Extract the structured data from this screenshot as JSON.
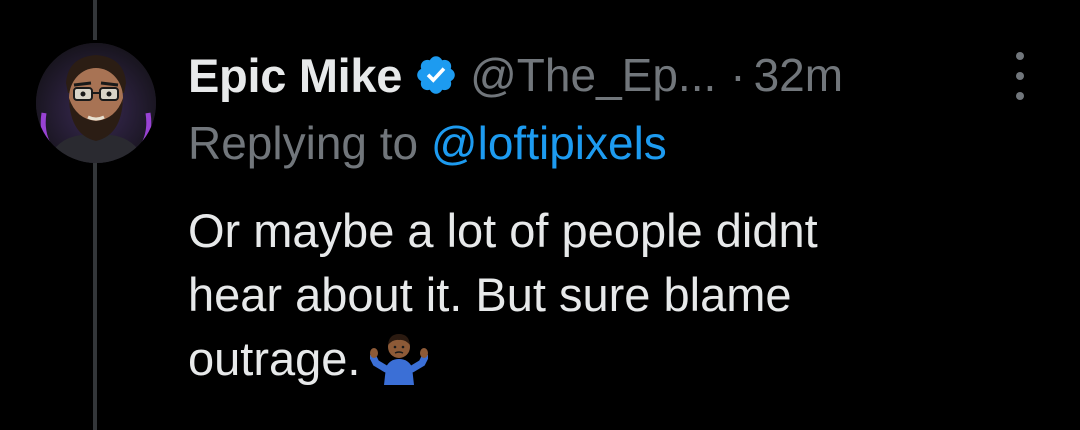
{
  "tweet": {
    "author_name": "Epic Mike",
    "author_handle": "@The_Ep...",
    "separator": "·",
    "timestamp": "32m",
    "reply_prefix": "Replying to",
    "reply_mention": "@loftipixels",
    "text_lines": [
      "Or maybe a lot of people didnt",
      "hear about it. But sure blame",
      "outrage."
    ],
    "emoji": "person-shrugging-emoji",
    "verified_icon": "verified-badge-icon",
    "more_icon": "more-options-icon"
  },
  "colors": {
    "background": "#000000",
    "primary_text": "#e7e9ea",
    "secondary_text": "#71767b",
    "link": "#1d9bf0",
    "thread_line": "#333639"
  }
}
